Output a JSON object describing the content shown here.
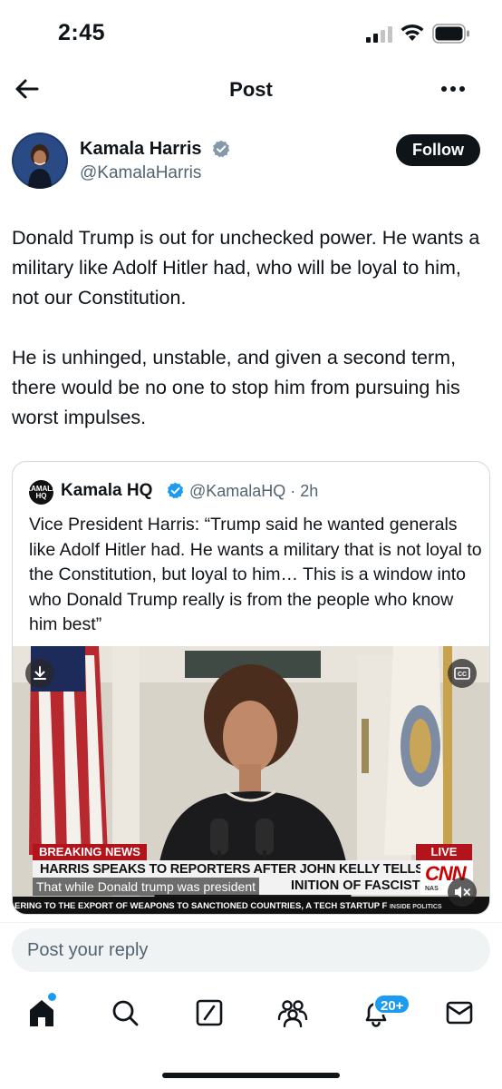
{
  "status_bar": {
    "time": "2:45"
  },
  "header": {
    "title": "Post"
  },
  "author": {
    "name": "Kamala Harris",
    "handle": "@KamalaHarris",
    "follow_label": "Follow"
  },
  "post": {
    "paragraphs": [
      "Donald Trump is out for unchecked power. He wants a military like Adolf Hitler had, who will be loyal to him, not our Constitution.",
      "He is unhinged, unstable, and given a second term, there would be no one to stop him from pursuing his worst impulses."
    ]
  },
  "quote": {
    "avatar_text": "KAMALA HQ",
    "name": "Kamala HQ",
    "handle_time": "@KamalaHQ · 2h",
    "text": "Vice President Harris: “Trump said he wanted generals like Adolf Hitler had. He wants a military that is not loyal to the Constitution, but loyal to him… This is a window into who Donald Trump really is from the people who know him best”",
    "video": {
      "breaking_label": "BREAKING NEWS",
      "live_label": "LIVE",
      "headline": "HARRIS SPEAKS TO REPORTERS AFTER JOHN KELLY TELLS",
      "headline_tail": "INITION OF FASCIST\"",
      "caption": "That while Donald trump was president",
      "network_logo": "CNN",
      "network_sub": "NAS",
      "ticker": "ERING TO THE EXPORT OF WEAPONS TO SANCTIONED COUNTRIES, A TECH STARTUP F",
      "ticker_tag": "INSIDE POLITICS",
      "cc_label": "CC"
    }
  },
  "reply": {
    "placeholder": "Post your reply"
  },
  "tabs": {
    "notifications_badge": "20+"
  },
  "colors": {
    "accent": "#1d9bf0",
    "text_primary": "#0f1419",
    "text_secondary": "#536471",
    "breaking_red": "#b3141b"
  },
  "icons": [
    "back-arrow-icon",
    "more-icon",
    "verified-icon",
    "download-icon",
    "cc-icon",
    "mute-icon",
    "home-icon",
    "search-icon",
    "grok-icon",
    "communities-icon",
    "bell-icon",
    "mail-icon"
  ]
}
